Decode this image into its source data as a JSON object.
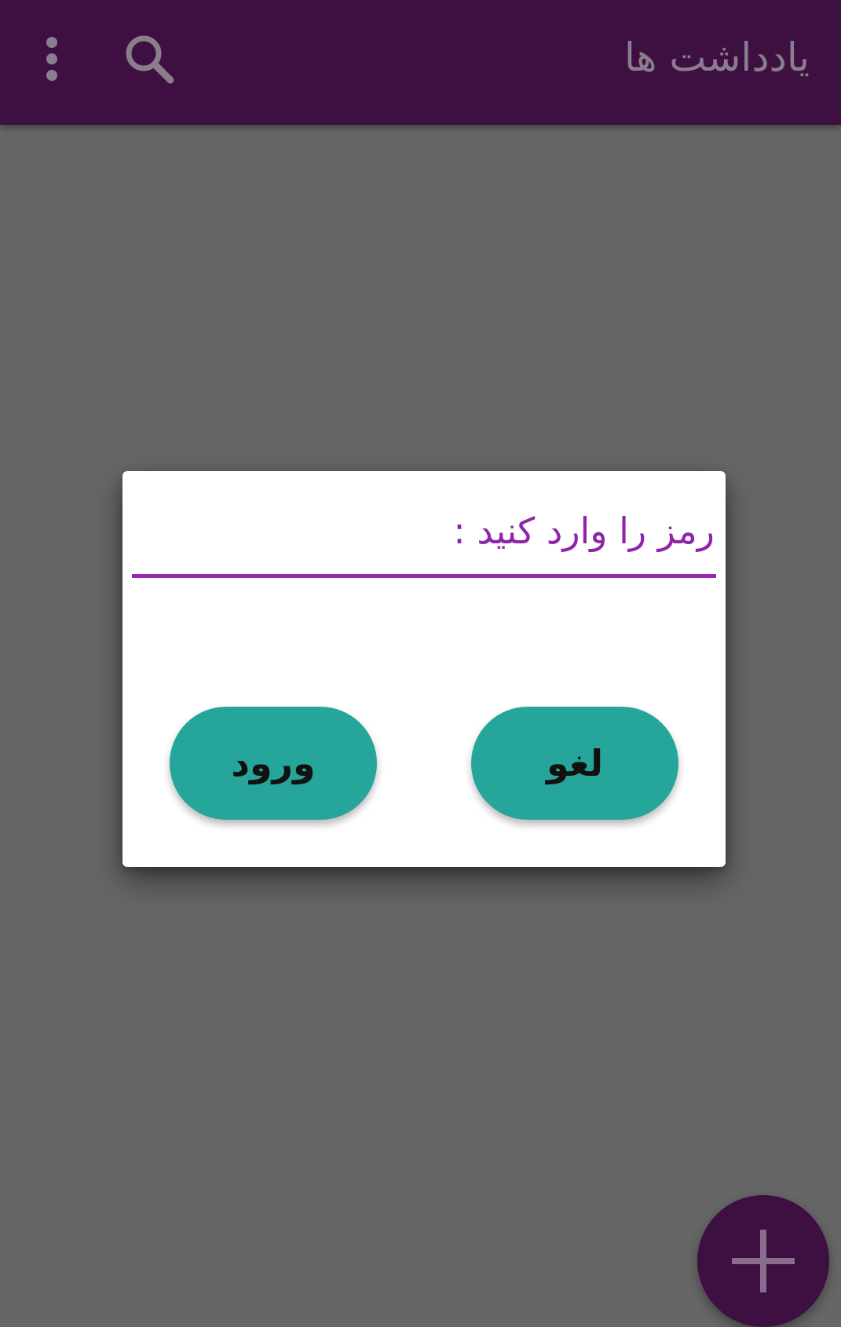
{
  "appbar": {
    "title": "یادداشت ها",
    "background_color": "#3e1042",
    "icons": [
      "search-icon",
      "more-vert-icon"
    ]
  },
  "dialog": {
    "password_placeholder": "رمز را وارد کنید :",
    "password_value": "",
    "login_label": "ورود",
    "cancel_label": "لغو",
    "accent_color": "#9c27b0",
    "button_color": "#26a69a"
  },
  "fab": {
    "icon": "plus-icon"
  }
}
